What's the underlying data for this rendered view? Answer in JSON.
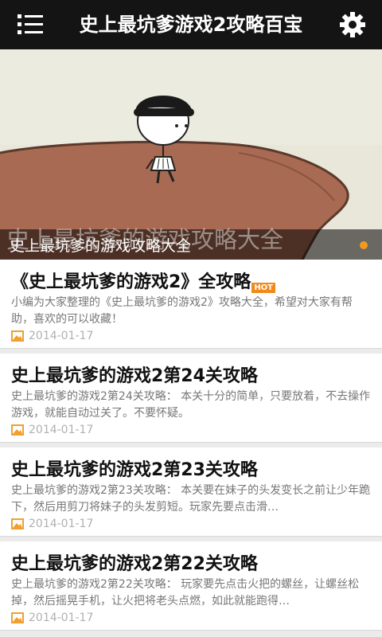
{
  "app": {
    "title": "史上最坑爹游戏2攻略百宝"
  },
  "banner": {
    "caption": "史上最坑爹的游戏攻略大全",
    "caption_overlay": "史上最坑爹的游戏攻略大全"
  },
  "colors": {
    "accent": "#f39a1e",
    "topbar": "#141414"
  },
  "articles": [
    {
      "title": "《史上最坑爹的游戏2》全攻略",
      "badge": "HOT",
      "summary": "小编为大家整理的《史上最坑爹的游戏2》攻略大全，希望对大家有帮助，喜欢的可以收藏！",
      "date": "2014-01-17"
    },
    {
      "title": "史上最坑爹的游戏2第24关攻略",
      "summary": "史上最坑爹的游戏2第24关攻略： 本关十分的简单，只要放着，不去操作游戏，就能自动过关了。不要怀疑。",
      "date": "2014-01-17"
    },
    {
      "title": "史上最坑爹的游戏2第23关攻略",
      "summary": "史上最坑爹的游戏2第23关攻略： 本关要在妹子的头发变长之前让少年跪下，然后用剪刀将妹子的头发剪短。玩家先要点击滑…",
      "date": "2014-01-17"
    },
    {
      "title": "史上最坑爹的游戏2第22关攻略",
      "summary": "史上最坑爹的游戏2第22关攻略： 玩家要先点击火把的螺丝，让螺丝松掉，然后摇晃手机，让火把将老头点燃，如此就能跑得…",
      "date": "2014-01-17"
    }
  ]
}
